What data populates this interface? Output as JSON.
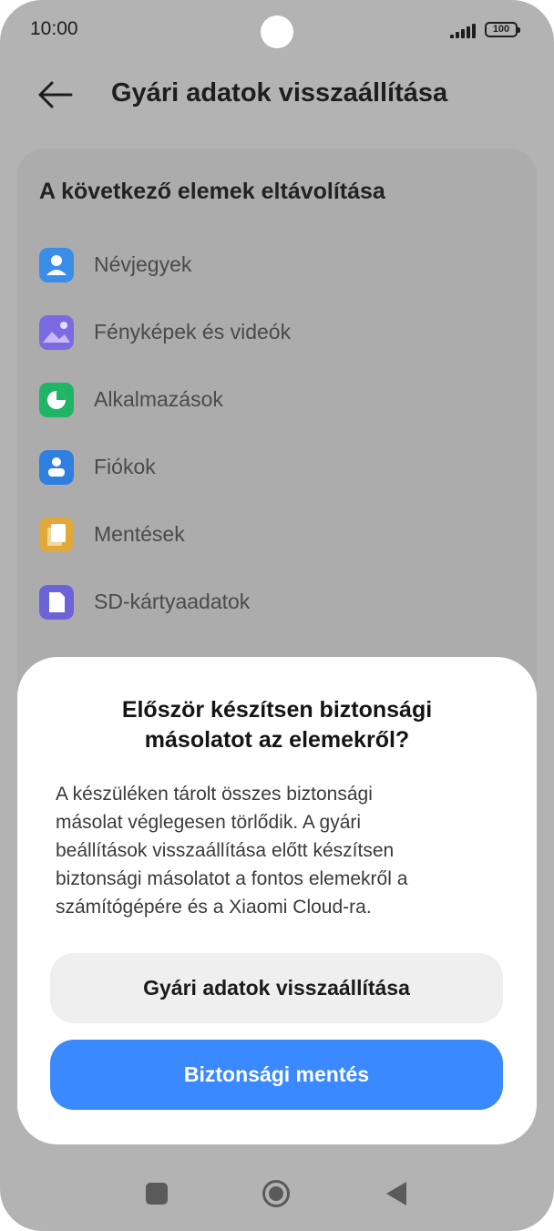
{
  "status_bar": {
    "time": "10:00",
    "battery": "100"
  },
  "header": {
    "title": "Gyári adatok visszaállítása"
  },
  "section": {
    "title": "A következő elemek eltávolítása",
    "items": [
      {
        "label": "Névjegyek",
        "icon": "contacts-icon",
        "color": "#3a8ee8"
      },
      {
        "label": "Fényképek és videók",
        "icon": "gallery-icon",
        "color": "#7b6be0"
      },
      {
        "label": "Alkalmazások",
        "icon": "apps-icon",
        "color": "#1fb565"
      },
      {
        "label": "Fiókok",
        "icon": "account-icon",
        "color": "#2f7fe0"
      },
      {
        "label": "Mentések",
        "icon": "backup-icon",
        "color": "#e0a93a"
      },
      {
        "label": "SD-kártyaadatok",
        "icon": "sd-card-icon",
        "color": "#6b63d6"
      }
    ]
  },
  "dialog": {
    "title": "Először készítsen biztonsági\nmásolatot az elemekről?",
    "body": "A készüléken tárolt összes biztonsági\nmásolat véglegesen törlődik. A gyári\nbeállítások visszaállítása előtt készítsen\nbiztonsági másolatot a fontos elemekről a\nszámítógépére és a Xiaomi Cloud-ra.",
    "reset_label": "Gyári adatok visszaállítása",
    "backup_label": "Biztonsági mentés"
  },
  "colors": {
    "accent": "#3a89ff",
    "overlay": "#b3b3b3"
  }
}
